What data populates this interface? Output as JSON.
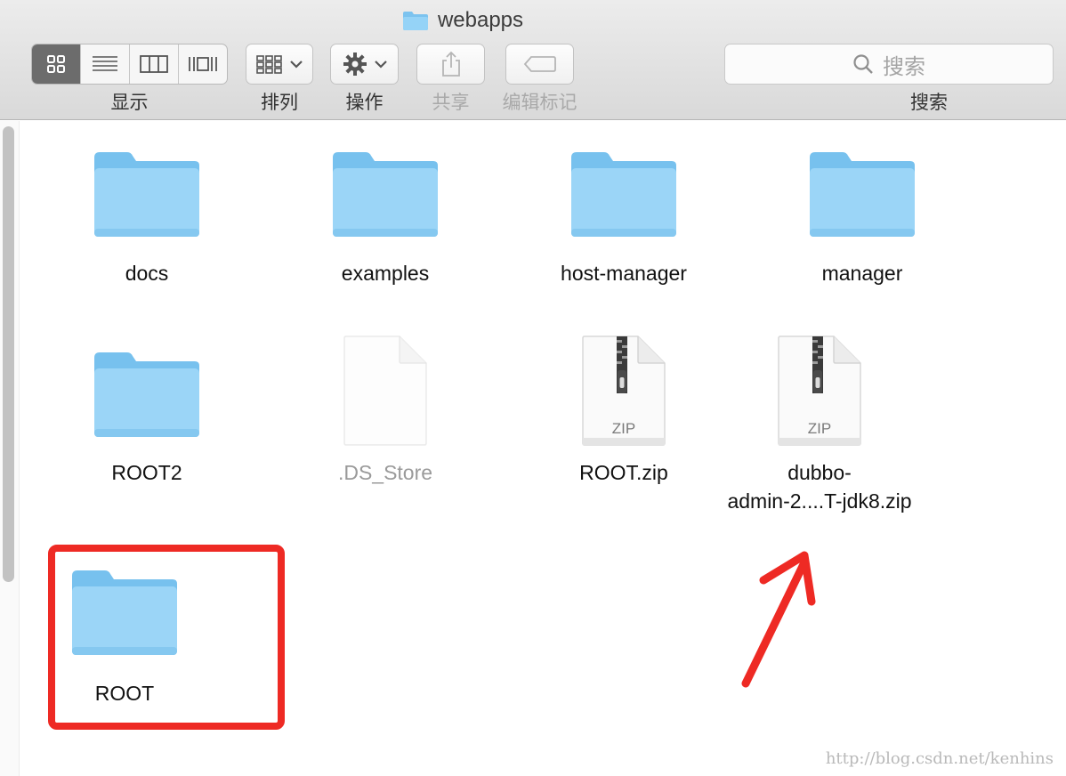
{
  "window": {
    "title": "webapps"
  },
  "toolbar": {
    "view_label": "显示",
    "arrange_label": "排列",
    "action_label": "操作",
    "share_label": "共享",
    "tags_label": "编辑标记",
    "search_placeholder": "搜索",
    "search_label": "搜索"
  },
  "files": [
    {
      "name": "docs",
      "kind": "folder"
    },
    {
      "name": "examples",
      "kind": "folder"
    },
    {
      "name": "host-manager",
      "kind": "folder"
    },
    {
      "name": "manager",
      "kind": "folder"
    },
    {
      "name": "ROOT2",
      "kind": "folder"
    },
    {
      "name": ".DS_Store",
      "kind": "hidden-file"
    },
    {
      "name": "ROOT.zip",
      "kind": "zip",
      "badge": "ZIP"
    },
    {
      "name_line1": "dubbo-",
      "name_line2": "admin-2....T-jdk8.zip",
      "kind": "zip",
      "badge": "ZIP"
    },
    {
      "name": "ROOT",
      "kind": "folder"
    }
  ],
  "annotation": {
    "highlight_color": "#ee2a24",
    "arrow_color": "#ee2a24"
  },
  "watermark": "http://blog.csdn.net/kenhins",
  "colors": {
    "folder": "#8fd0f6",
    "accent_selected": "#6c6c6c"
  }
}
